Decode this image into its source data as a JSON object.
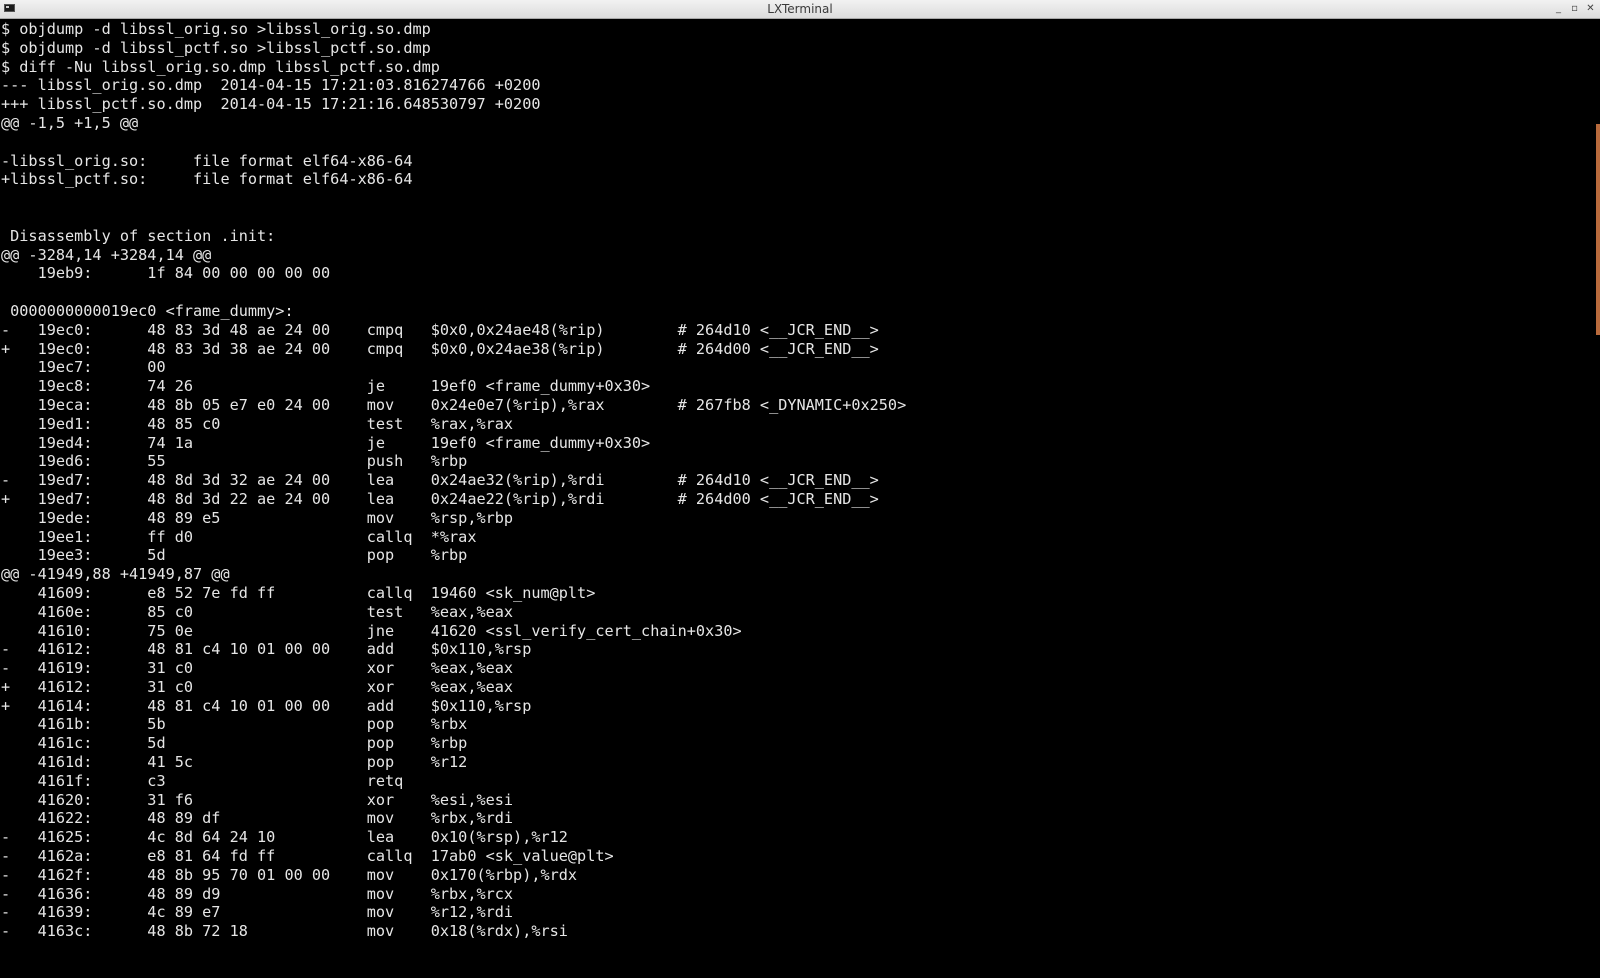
{
  "window": {
    "title": "LXTerminal",
    "controls": [
      "_",
      "▫",
      "✕"
    ]
  },
  "terminal": {
    "lines": [
      "$ objdump -d libssl_orig.so >libssl_orig.so.dmp",
      "$ objdump -d libssl_pctf.so >libssl_pctf.so.dmp",
      "$ diff -Nu libssl_orig.so.dmp libssl_pctf.so.dmp",
      "--- libssl_orig.so.dmp  2014-04-15 17:21:03.816274766 +0200",
      "+++ libssl_pctf.so.dmp  2014-04-15 17:21:16.648530797 +0200",
      "@@ -1,5 +1,5 @@",
      "",
      "-libssl_orig.so:     file format elf64-x86-64",
      "+libssl_pctf.so:     file format elf64-x86-64",
      "",
      "",
      " Disassembly of section .init:",
      "@@ -3284,14 +3284,14 @@",
      "    19eb9:      1f 84 00 00 00 00 00",
      "",
      " 0000000000019ec0 <frame_dummy>:",
      "-   19ec0:      48 83 3d 48 ae 24 00    cmpq   $0x0,0x24ae48(%rip)        # 264d10 <__JCR_END__>",
      "+   19ec0:      48 83 3d 38 ae 24 00    cmpq   $0x0,0x24ae38(%rip)        # 264d00 <__JCR_END__>",
      "    19ec7:      00",
      "    19ec8:      74 26                   je     19ef0 <frame_dummy+0x30>",
      "    19eca:      48 8b 05 e7 e0 24 00    mov    0x24e0e7(%rip),%rax        # 267fb8 <_DYNAMIC+0x250>",
      "    19ed1:      48 85 c0                test   %rax,%rax",
      "    19ed4:      74 1a                   je     19ef0 <frame_dummy+0x30>",
      "    19ed6:      55                      push   %rbp",
      "-   19ed7:      48 8d 3d 32 ae 24 00    lea    0x24ae32(%rip),%rdi        # 264d10 <__JCR_END__>",
      "+   19ed7:      48 8d 3d 22 ae 24 00    lea    0x24ae22(%rip),%rdi        # 264d00 <__JCR_END__>",
      "    19ede:      48 89 e5                mov    %rsp,%rbp",
      "    19ee1:      ff d0                   callq  *%rax",
      "    19ee3:      5d                      pop    %rbp",
      "@@ -41949,88 +41949,87 @@",
      "    41609:      e8 52 7e fd ff          callq  19460 <sk_num@plt>",
      "    4160e:      85 c0                   test   %eax,%eax",
      "    41610:      75 0e                   jne    41620 <ssl_verify_cert_chain+0x30>",
      "-   41612:      48 81 c4 10 01 00 00    add    $0x110,%rsp",
      "-   41619:      31 c0                   xor    %eax,%eax",
      "+   41612:      31 c0                   xor    %eax,%eax",
      "+   41614:      48 81 c4 10 01 00 00    add    $0x110,%rsp",
      "    4161b:      5b                      pop    %rbx",
      "    4161c:      5d                      pop    %rbp",
      "    4161d:      41 5c                   pop    %r12",
      "    4161f:      c3                      retq",
      "    41620:      31 f6                   xor    %esi,%esi",
      "    41622:      48 89 df                mov    %rbx,%rdi",
      "-   41625:      4c 8d 64 24 10          lea    0x10(%rsp),%r12",
      "-   4162a:      e8 81 64 fd ff          callq  17ab0 <sk_value@plt>",
      "-   4162f:      48 8b 95 70 01 00 00    mov    0x170(%rbp),%rdx",
      "-   41636:      48 89 d9                mov    %rbx,%rcx",
      "-   41639:      4c 89 e7                mov    %r12,%rdi",
      "-   4163c:      48 8b 72 18             mov    0x18(%rdx),%rsi"
    ]
  },
  "colors": {
    "background": "#000000",
    "foreground": "#e6e6e6",
    "scroll_thumb": "#b86a3c"
  }
}
